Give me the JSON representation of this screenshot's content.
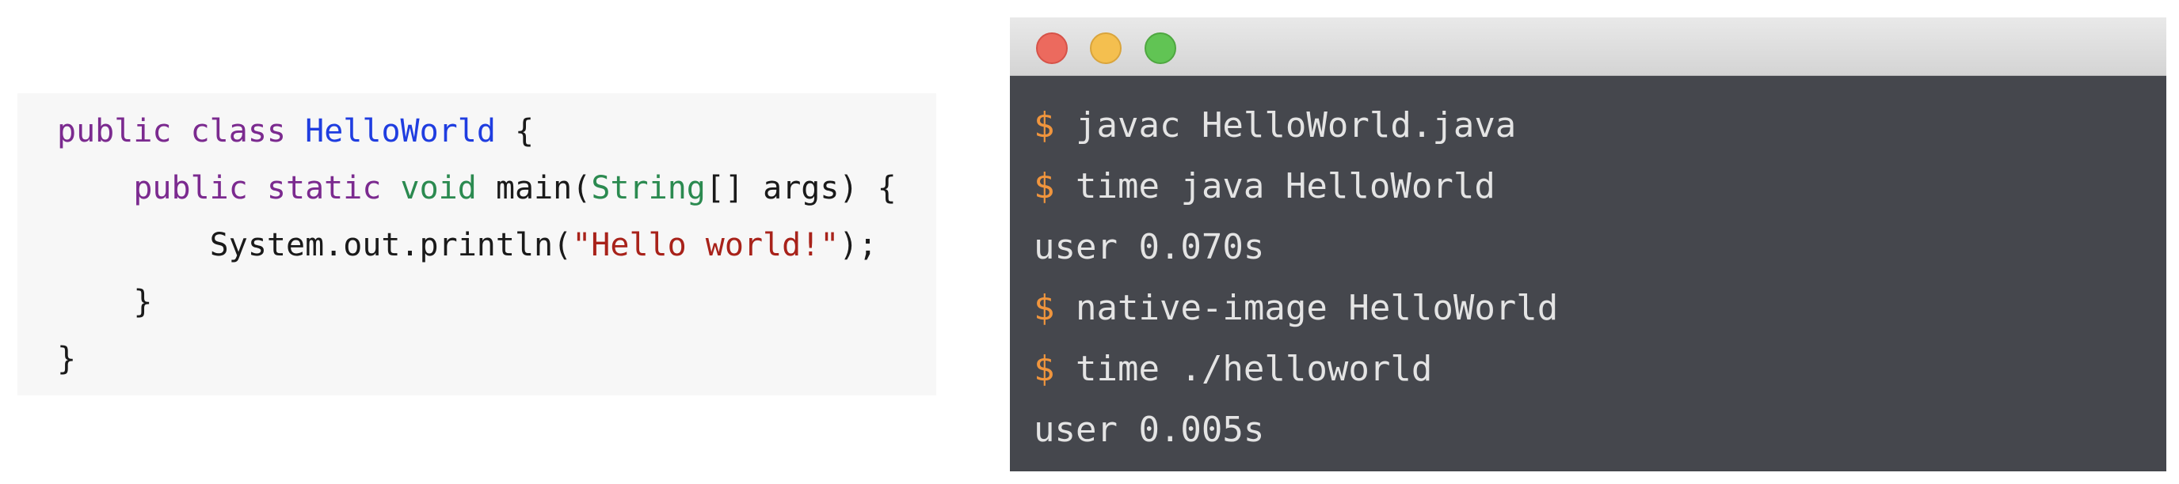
{
  "code": {
    "line1": {
      "kw1": "public",
      "kw2": "class",
      "class_name": "HelloWorld",
      "brace": "{"
    },
    "line2": {
      "kw1": "public",
      "kw2": "static",
      "ret_type": "void",
      "method": "main(",
      "param_type": "String",
      "rest": "[] args) {"
    },
    "line3": {
      "call": "System.out.println(",
      "string": "\"Hello world!\"",
      "end": ");"
    },
    "line4": "}",
    "line5": "}"
  },
  "terminal": {
    "prompt_symbol": "$",
    "lines": [
      {
        "type": "command",
        "text": "javac HelloWorld.java"
      },
      {
        "type": "command",
        "text": "time java HelloWorld"
      },
      {
        "type": "output",
        "text": "user 0.070s"
      },
      {
        "type": "command",
        "text": "native-image HelloWorld"
      },
      {
        "type": "command",
        "text": "time ./helloworld"
      },
      {
        "type": "output",
        "text": "user 0.005s"
      }
    ]
  },
  "colors": {
    "keyword": "#7b2a8f",
    "class_name": "#1f3de0",
    "type": "#2b8a50",
    "string": "#a8221a",
    "prompt": "#f0953d",
    "terminal_bg": "#45474d",
    "terminal_text": "#e4e4e4",
    "code_bg": "#f7f7f7"
  }
}
